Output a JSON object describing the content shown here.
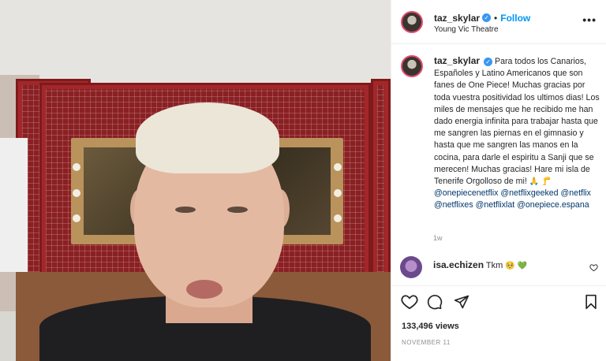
{
  "post": {
    "username": "taz_skylar",
    "follow_label": "Follow",
    "separator": "•",
    "location": "Young Vic Theatre",
    "more_label": "•••"
  },
  "caption": {
    "username": "taz_skylar",
    "text": "Para todos los Canarios, Españoles y Latino Americanos que son fanes de One Piece! Muchas gracias por toda vuestra positividad los ultimos dias! Los miles de mensajes que he recibido me han dado energia infinita para trabajar hasta que me sangren las piernas en el gimnasio y hasta que me sangren las manos en la cocina, para darle el espiritu a Sanji que se merecen! Muchas gracias! Hare mi isla de Tenerife Orgolloso de mi!",
    "emojis": "🙏 🦵",
    "tags": [
      "@onepiecenetflix",
      "@netflixgeeked",
      "@netflix",
      "@netflixes",
      "@netflixlat",
      "@onepiece.espana"
    ],
    "time_ago": "1w"
  },
  "comment": {
    "username": "isa.echizen",
    "text": "Tkm",
    "emojis": "🥺 💚"
  },
  "stats": {
    "views": "133,496 views",
    "date": "NOVEMBER 11"
  },
  "icons": {
    "like": "heart-icon",
    "comment": "comment-icon",
    "share": "send-icon",
    "save": "bookmark-icon",
    "verified": "verified-badge-icon",
    "comment_like": "heart-outline-icon"
  },
  "colors": {
    "follow_blue": "#0095f6",
    "verified_blue": "#3897f0",
    "tag_blue": "#00376b",
    "muted_gray": "#8e8e8e"
  }
}
